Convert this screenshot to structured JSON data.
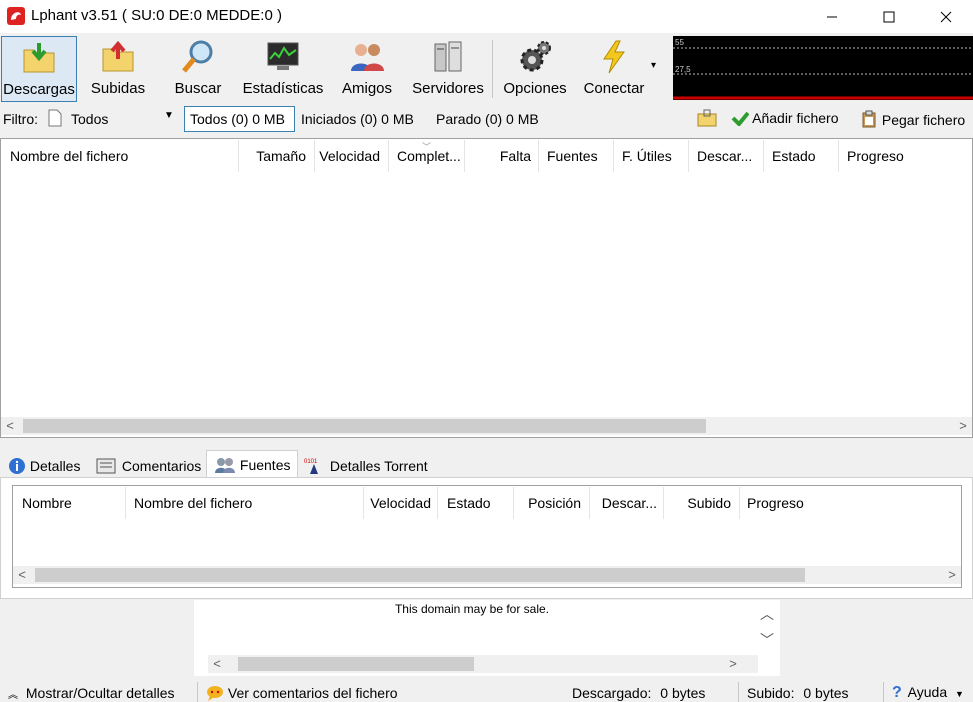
{
  "window": {
    "title": "Lphant v3.51 ( SU:0 DE:0 MEDDE:0 )"
  },
  "toolbar": {
    "descargas": "Descargas",
    "subidas": "Subidas",
    "buscar": "Buscar",
    "estadisticas": "Estadísticas",
    "amigos": "Amigos",
    "servidores": "Servidores",
    "opciones": "Opciones",
    "conectar": "Conectar"
  },
  "graph": {
    "top_value": "55",
    "mid_value": "27,5"
  },
  "filter": {
    "label": "Filtro:",
    "selected": "Todos",
    "tab_todos": "Todos (0) 0 MB",
    "tab_iniciados": "Iniciados (0)  0 MB",
    "tab_parado": "Parado (0)  0 MB",
    "add_file": "Añadir fichero",
    "paste_file": "Pegar fichero"
  },
  "download_columns": [
    "Nombre del fichero",
    "Tamaño",
    "Velocidad",
    "Complet...",
    "Falta",
    "Fuentes",
    "F. Útiles",
    "Descar...",
    "Estado",
    "Progreso"
  ],
  "lower_tabs": [
    "Detalles",
    "Comentarios",
    "Fuentes",
    "Detalles Torrent"
  ],
  "source_columns": [
    "Nombre",
    "Nombre del fichero",
    "Velocidad",
    "Estado",
    "Posición",
    "Descar...",
    "Subido",
    "Progreso"
  ],
  "ad": {
    "text": "This domain may be for sale."
  },
  "status": {
    "toggle_details": "Mostrar/Ocultar detalles",
    "view_comments": "Ver comentarios del fichero",
    "downloaded_label": "Descargado:",
    "downloaded_value": "0 bytes",
    "uploaded_label": "Subido:",
    "uploaded_value": "0 bytes",
    "help": "Ayuda"
  }
}
